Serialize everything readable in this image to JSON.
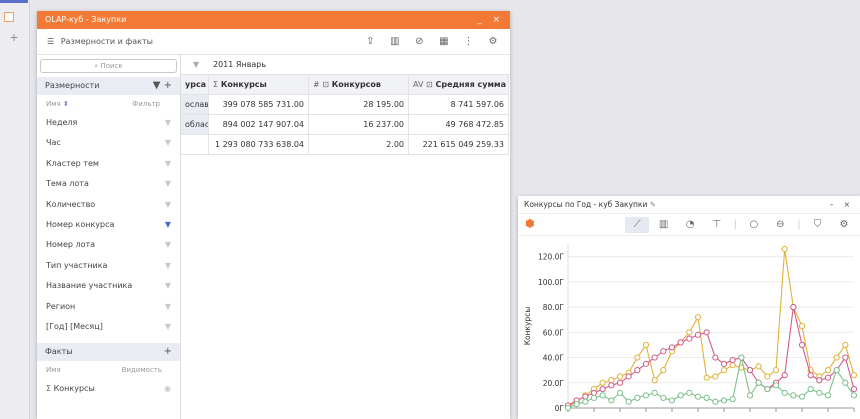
{
  "olap": {
    "title": "OLAP-куб - Закупки",
    "window_controls": "_ ×",
    "toolbar_label": "Размерности и факты",
    "search_placeholder": "Поиск",
    "dimensions_header": "Размерности",
    "col_name": "Имя",
    "col_filter": "Фильтр",
    "dimensions": [
      {
        "label": "Неделя",
        "filtered": false
      },
      {
        "label": "Час",
        "filtered": false
      },
      {
        "label": "Кластер тем",
        "filtered": false
      },
      {
        "label": "Тема лота",
        "filtered": false
      },
      {
        "label": "Количество",
        "filtered": false
      },
      {
        "label": "Номер конкурса",
        "filtered": true
      },
      {
        "label": "Номер лота",
        "filtered": false
      },
      {
        "label": "Тип участника",
        "filtered": false
      },
      {
        "label": "Название участника",
        "filtered": false
      },
      {
        "label": "Регион",
        "filtered": false
      },
      {
        "label": "[Год] [Месяц]",
        "filtered": false
      }
    ],
    "facts_header": "Факты",
    "facts_col_name": "Имя",
    "facts_col_visibility": "Видимость",
    "facts": [
      {
        "label": "Конкурсы"
      }
    ],
    "filter_value": "2011 Январь",
    "grid": {
      "headers": [
        "урса",
        "Конкурсы",
        "Конкурсов",
        "Средняя сумма к"
      ],
      "header_prefixes": [
        "",
        "Σ",
        "# ⊡",
        "AV ⊡"
      ],
      "rows": [
        [
          "ославс",
          "399 078 585 731.00",
          "28 195.00",
          "8 741 597.06"
        ],
        [
          "облас",
          "894 002 147 907.04",
          "16 237.00",
          "49 768 472.85"
        ],
        [
          "",
          "1 293 080 733 638.04",
          "2.00",
          "221 615 049 259.33"
        ]
      ]
    }
  },
  "chart_window": {
    "title": "Конкурсы по Год - куб Закупки",
    "window_controls": "– ×"
  },
  "colors": {
    "accent": "#f37a36",
    "series_gold": "#e0b23a",
    "series_pink": "#d45a8a",
    "series_green": "#7cc08a"
  },
  "chart_data": {
    "type": "line",
    "ylabel": "Конкурсы",
    "yticks": [
      "0Г",
      "20.0Г",
      "40.0Г",
      "60.0Г",
      "80.0Г",
      "100.0Г",
      "120.0Г"
    ],
    "ylim": [
      0,
      130
    ],
    "x": [
      1,
      2,
      3,
      4,
      5,
      6,
      7,
      8,
      9,
      10,
      11,
      12,
      13,
      14,
      15,
      16,
      17,
      18,
      19,
      20,
      21,
      22,
      23,
      24,
      25,
      26,
      27,
      28,
      29,
      30,
      31,
      32,
      33,
      34
    ],
    "series": [
      {
        "name": "",
        "color": "#e0b23a",
        "values": [
          1,
          5,
          10,
          15,
          20,
          22,
          25,
          28,
          40,
          50,
          22,
          30,
          45,
          52,
          60,
          72,
          24,
          25,
          30,
          34,
          32,
          30,
          33,
          25,
          30,
          126,
          80,
          65,
          30,
          25,
          30,
          40,
          50,
          26
        ]
      },
      {
        "name": "",
        "color": "#d45a8a",
        "values": [
          2,
          6,
          9,
          12,
          15,
          18,
          20,
          25,
          30,
          35,
          40,
          45,
          48,
          52,
          55,
          58,
          60,
          40,
          35,
          38,
          40,
          30,
          20,
          15,
          20,
          26,
          80,
          50,
          26,
          22,
          24,
          30,
          40,
          15
        ]
      },
      {
        "name": "",
        "color": "#7cc08a",
        "values": [
          0,
          3,
          5,
          8,
          10,
          6,
          12,
          5,
          8,
          10,
          12,
          8,
          6,
          10,
          12,
          9,
          8,
          5,
          6,
          7,
          40,
          10,
          20,
          15,
          18,
          12,
          10,
          9,
          15,
          12,
          10,
          30,
          20,
          10
        ]
      }
    ]
  }
}
